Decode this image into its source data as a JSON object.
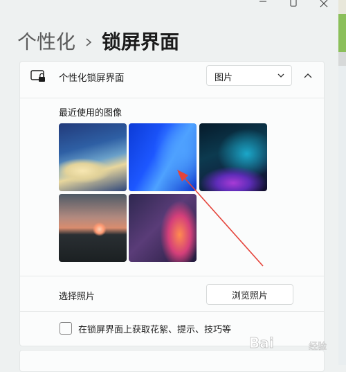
{
  "window": {
    "controls": {
      "minimize_icon": "minimize-icon",
      "maximize_icon": "maximize-icon",
      "close_icon": "close-icon"
    }
  },
  "breadcrumb": {
    "parent": "个性化",
    "separator_icon": "chevron-right-icon",
    "current": "锁屏界面"
  },
  "lock_screen": {
    "icon": "lock-screen-icon",
    "label": "个性化锁屏界面",
    "dropdown_value": "图片",
    "dropdown_icon": "chevron-down-icon",
    "collapse_icon": "chevron-up-icon",
    "recent_images_label": "最近使用的图像",
    "recent_images": [
      {
        "name": "wallpaper-whale-bay"
      },
      {
        "name": "wallpaper-blue-bloom"
      },
      {
        "name": "wallpaper-dark-glow"
      },
      {
        "name": "wallpaper-sunset-lake"
      },
      {
        "name": "wallpaper-purple-swirl"
      }
    ],
    "choose_photo_label": "选择照片",
    "browse_button": "浏览照片",
    "tips_checkbox_label": "在锁屏界面上获取花絮、提示、技巧等",
    "tips_checked": false
  },
  "watermark": {
    "text": "Bai",
    "sub": "经验"
  },
  "colors": {
    "accent_arrow": "#e5433a",
    "panel_bg": "#fbfcfc",
    "window_bg": "#eef1f1"
  }
}
